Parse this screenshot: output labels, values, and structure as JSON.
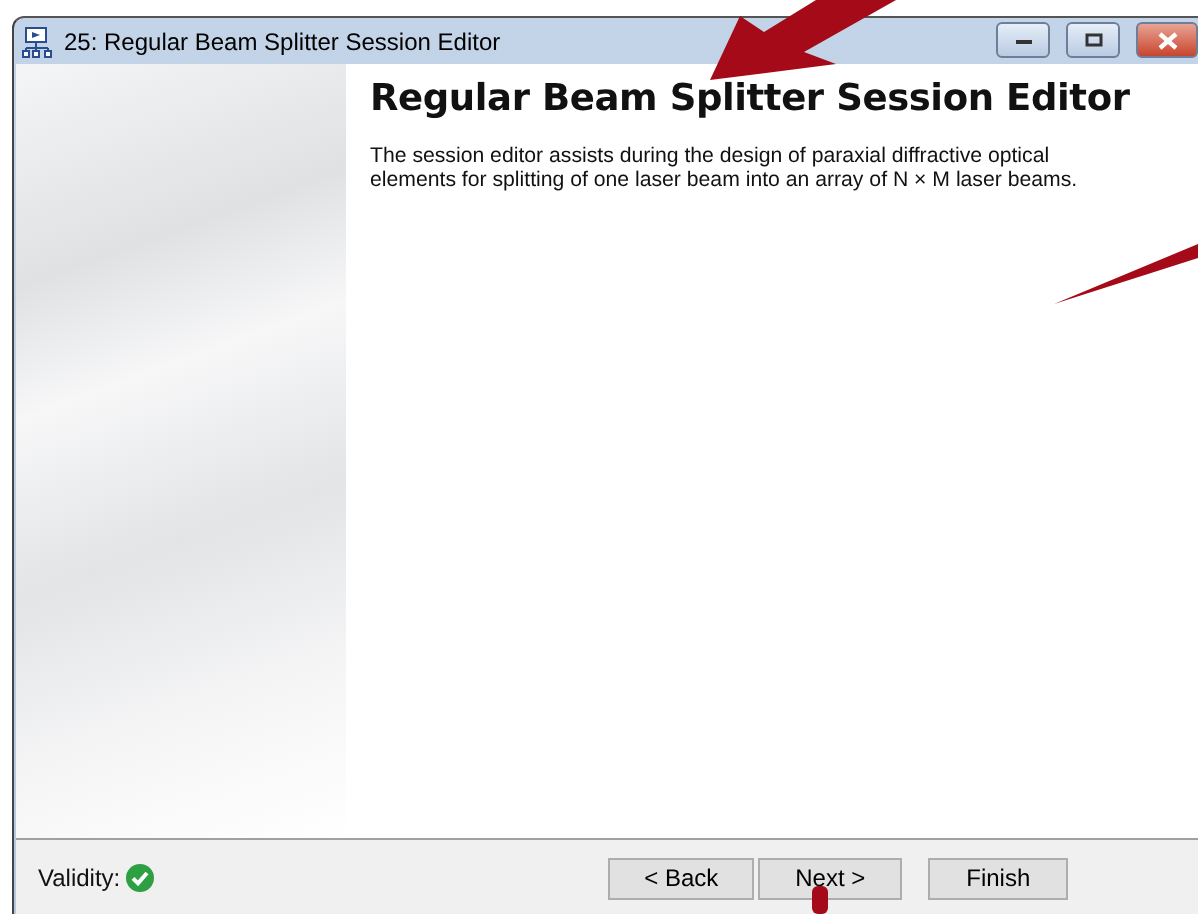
{
  "window": {
    "title": "25: Regular Beam Splitter Session Editor"
  },
  "page": {
    "heading": "Regular Beam Splitter Session Editor",
    "description": "The session editor assists during the design of paraxial diffractive optical elements for splitting of one laser beam into an array of N × M laser beams."
  },
  "footer": {
    "validity_label": "Validity:",
    "valid": true,
    "buttons": [
      {
        "label": "< Back",
        "kind": "back"
      },
      {
        "label": "Next >",
        "kind": "next"
      },
      {
        "label": "Finish",
        "kind": "finish"
      }
    ]
  }
}
